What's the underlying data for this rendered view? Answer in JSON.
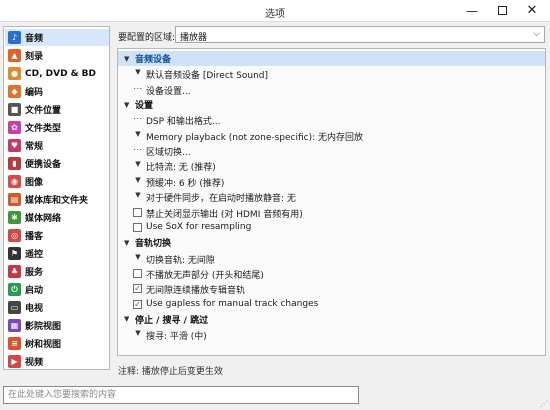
{
  "window": {
    "title": "选项"
  },
  "sidebar": {
    "items": [
      {
        "label": "音频",
        "icon": "music-note-icon",
        "color": "#2c6fc7",
        "glyph": "♪",
        "selected": true
      },
      {
        "label": "刻录",
        "icon": "fire-icon",
        "color": "#e0612a",
        "glyph": "▲"
      },
      {
        "label": "CD, DVD & BD",
        "icon": "disc-icon",
        "color": "#e3882b",
        "glyph": "●"
      },
      {
        "label": "编码",
        "icon": "encode-icon",
        "color": "#e0722a",
        "glyph": "◆"
      },
      {
        "label": "文件位置",
        "icon": "folder-icon",
        "color": "#555555",
        "glyph": "■"
      },
      {
        "label": "文件类型",
        "icon": "file-types-icon",
        "color": "#c43fa8",
        "glyph": "✿"
      },
      {
        "label": "常规",
        "icon": "general-icon",
        "color": "#c23b6a",
        "glyph": "♥"
      },
      {
        "label": "便携设备",
        "icon": "portable-device-icon",
        "color": "#b83a3a",
        "glyph": "▮"
      },
      {
        "label": "图像",
        "icon": "image-icon",
        "color": "#d94a4a",
        "glyph": "◉"
      },
      {
        "label": "媒体库和文件夹",
        "icon": "library-icon",
        "color": "#d35a2a",
        "glyph": "▤"
      },
      {
        "label": "媒体网络",
        "icon": "network-icon",
        "color": "#3a9a3a",
        "glyph": "✱"
      },
      {
        "label": "播客",
        "icon": "podcast-icon",
        "color": "#d04848",
        "glyph": "◎"
      },
      {
        "label": "遥控",
        "icon": "remote-icon",
        "color": "#333333",
        "glyph": "⚑"
      },
      {
        "label": "服务",
        "icon": "service-icon",
        "color": "#c8344a",
        "glyph": "♣"
      },
      {
        "label": "启动",
        "icon": "power-icon",
        "color": "#2e9a4e",
        "glyph": "⏻"
      },
      {
        "label": "电视",
        "icon": "tv-icon",
        "color": "#444444",
        "glyph": "▭"
      },
      {
        "label": "影院视图",
        "icon": "theater-view-icon",
        "color": "#7a4ab8",
        "glyph": "▦"
      },
      {
        "label": "树和视图",
        "icon": "tree-view-icon",
        "color": "#d8532e",
        "glyph": "≡"
      },
      {
        "label": "视频",
        "icon": "video-icon",
        "color": "#d64545",
        "glyph": "▶"
      }
    ]
  },
  "region": {
    "label": "要配置的区域:",
    "value": "播放器",
    "chevron_icon": "chevron-down-icon"
  },
  "panel": {
    "sections": [
      {
        "title": "音频设备",
        "active": true,
        "rows": [
          {
            "mark": "arrow",
            "text": "默认音频设备 [Direct Sound]"
          },
          {
            "mark": "dots",
            "text": "设备设置..."
          }
        ]
      },
      {
        "title": "设置",
        "rows": [
          {
            "mark": "dots",
            "text": "DSP 和输出格式..."
          },
          {
            "mark": "arrow",
            "text": "Memory playback (not zone-specific): 无内存回放"
          },
          {
            "mark": "dots",
            "text": "区域切换..."
          },
          {
            "mark": "arrow",
            "text": "比特流: 无 (推荐)"
          },
          {
            "mark": "arrow",
            "text": "预缓冲: 6 秒 (推荐)"
          },
          {
            "mark": "arrow",
            "text": "对于硬件同步，在启动时播放静音: 无"
          },
          {
            "mark": "checkbox",
            "checked": false,
            "text": "禁止关闭显示输出 (对 HDMI 音频有用)"
          },
          {
            "mark": "checkbox",
            "checked": false,
            "text": "Use SoX for resampling"
          }
        ]
      },
      {
        "title": "音轨切换",
        "rows": [
          {
            "mark": "arrow",
            "text": "切换音轨: 无间隙"
          },
          {
            "mark": "checkbox",
            "checked": false,
            "text": "不播放无声部分 (开头和结尾)"
          },
          {
            "mark": "checkbox",
            "checked": true,
            "text": "无间隙连续播放专辑音轨"
          },
          {
            "mark": "checkbox",
            "checked": true,
            "text": "Use gapless for manual track changes"
          }
        ]
      },
      {
        "title": "停止 / 搜寻 / 跳过",
        "rows": [
          {
            "mark": "arrow",
            "text": "搜寻: 平滑 (中)"
          }
        ]
      }
    ]
  },
  "note": "注释: 播放停止后变更生效",
  "search": {
    "placeholder": "在此处键入您要搜索的内容",
    "value": ""
  }
}
